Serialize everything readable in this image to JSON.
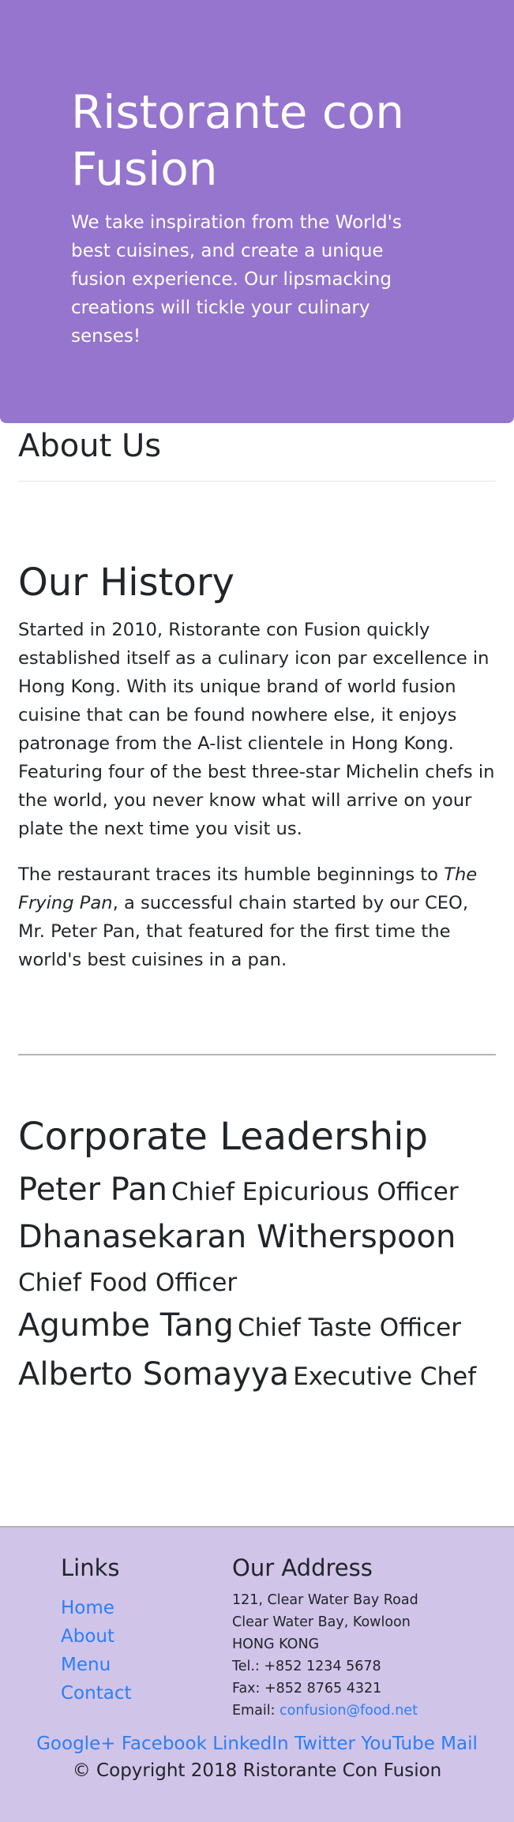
{
  "jumbotron": {
    "title_line1": "Ristorante con",
    "title_line2": "Fusion",
    "description": "We take inspiration from the World's best cuisines, and create a unique fusion experience. Our lipsmacking creations will tickle your culinary senses!"
  },
  "about": {
    "title": "About Us"
  },
  "history": {
    "title": "Our History",
    "paragraph1": "Started in 2010, Ristorante con Fusion quickly established itself as a culinary icon par excellence in Hong Kong. With its unique brand of world fusion cuisine that can be found nowhere else, it enjoys patronage from the A-list clientele in Hong Kong. Featuring four of the best three-star Michelin chefs in the world, you never know what will arrive on your plate the next time you visit us.",
    "paragraph2_before": "The restaurant traces its humble beginnings to ",
    "paragraph2_em": "The Frying Pan",
    "paragraph2_after": ", a successful chain started by our CEO, Mr. Peter Pan, that featured for the first time the world's best cuisines in a pan."
  },
  "leadership": {
    "title": "Corporate Leadership",
    "leaders": [
      {
        "name": "Peter Pan",
        "role": "Chief Epicurious Officer"
      },
      {
        "name": "Dhanasekaran Witherspoon",
        "role": "Chief Food Officer"
      },
      {
        "name": "Agumbe Tang",
        "role": "Chief Taste Officer"
      },
      {
        "name": "Alberto Somayya",
        "role": "Executive Chef"
      }
    ]
  },
  "footer": {
    "links_title": "Links",
    "links": [
      "Home",
      "About",
      "Menu",
      "Contact"
    ],
    "address_title": "Our Address",
    "address_lines": [
      "121, Clear Water Bay Road",
      "Clear Water Bay, Kowloon",
      "HONG KONG",
      "Tel.: +852 1234 5678",
      "Fax: +852 8765 4321"
    ],
    "email_label": "Email: ",
    "email": "confusion@food.net",
    "social": [
      "Google+",
      "Facebook",
      "LinkedIn",
      "Twitter",
      "YouTube",
      "Mail"
    ],
    "copyright": "© Copyright 2018 Ristorante Con Fusion"
  },
  "colors": {
    "jumbotron_bg": "#9575cd",
    "footer_bg": "#d1c4e9",
    "link": "#2a7ff5",
    "text": "#212529"
  }
}
